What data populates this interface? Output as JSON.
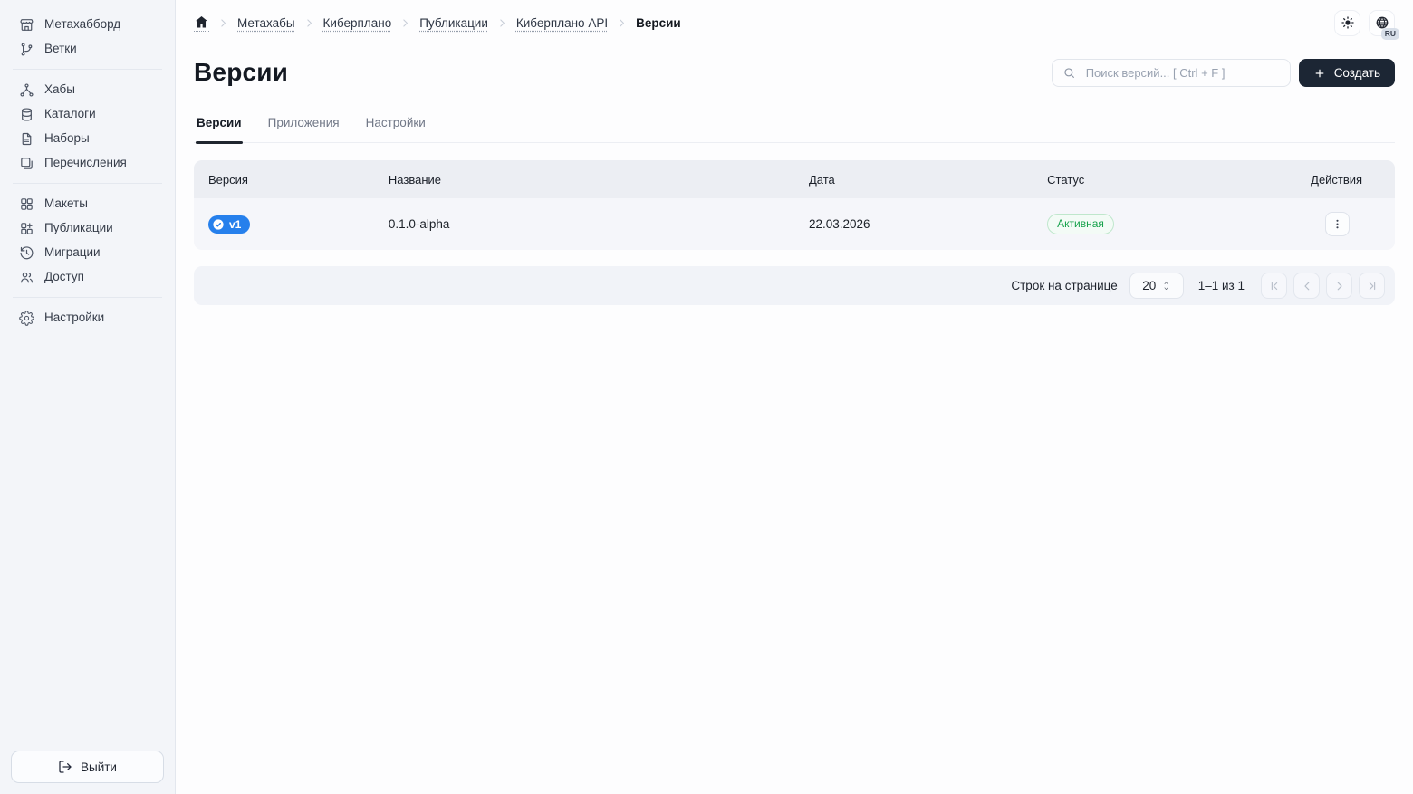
{
  "sidebar": {
    "groups": [
      {
        "items": [
          {
            "key": "metahubboard",
            "label": "Метахабборд",
            "icon": "storefront-icon"
          },
          {
            "key": "branches",
            "label": "Ветки",
            "icon": "git-branch-icon"
          }
        ]
      },
      {
        "items": [
          {
            "key": "hubs",
            "label": "Хабы",
            "icon": "hierarchy-icon"
          },
          {
            "key": "catalogs",
            "label": "Каталоги",
            "icon": "database-icon"
          },
          {
            "key": "sets",
            "label": "Наборы",
            "icon": "file-icon"
          },
          {
            "key": "enumerations",
            "label": "Перечисления",
            "icon": "copy-icon"
          }
        ]
      },
      {
        "items": [
          {
            "key": "layouts",
            "label": "Макеты",
            "icon": "layout-grid-icon"
          },
          {
            "key": "publications",
            "label": "Публикации",
            "icon": "grid-plus-icon"
          },
          {
            "key": "migrations",
            "label": "Миграции",
            "icon": "history-icon"
          },
          {
            "key": "access",
            "label": "Доступ",
            "icon": "users-icon"
          }
        ]
      },
      {
        "items": [
          {
            "key": "settings",
            "label": "Настройки",
            "icon": "gear-icon"
          }
        ]
      }
    ],
    "logout_label": "Выйти"
  },
  "topbar": {
    "language_badge": "RU"
  },
  "breadcrumb": {
    "items": [
      {
        "key": "metahubs",
        "label": "Метахабы",
        "type": "link"
      },
      {
        "key": "kiberplano",
        "label": "Киберплано",
        "type": "link"
      },
      {
        "key": "publications",
        "label": "Публикации",
        "type": "link"
      },
      {
        "key": "kiberplano-api",
        "label": "Киберплано API",
        "type": "link"
      },
      {
        "key": "versions",
        "label": "Версии",
        "type": "current"
      }
    ]
  },
  "page": {
    "title": "Версии",
    "search_placeholder": "Поиск версий... [ Ctrl + F ]",
    "create_label": "Создать",
    "tabs": [
      {
        "key": "versions",
        "label": "Версии",
        "active": true
      },
      {
        "key": "applications",
        "label": "Приложения",
        "active": false
      },
      {
        "key": "settings",
        "label": "Настройки",
        "active": false
      }
    ]
  },
  "table": {
    "columns": [
      "Версия",
      "Название",
      "Дата",
      "Статус",
      "Действия"
    ],
    "rows": [
      {
        "version_badge": "v1",
        "name": "0.1.0-alpha",
        "date": "22.03.2026",
        "status": "Активная"
      }
    ]
  },
  "pagination": {
    "rows_per_page_label": "Строк на странице",
    "rows_per_page": "20",
    "range": "1–1 из 1"
  },
  "colors": {
    "accent_blue": "#2680ec",
    "create_button": "#1c2634",
    "status_green": "#17a24c",
    "status_green_bg": "#f3fbf6",
    "status_green_border": "#bfe7cc",
    "sidebar_bg": "#f3f5f9",
    "table_header_bg": "#eceef3",
    "table_row_bg": "#f5f6fa"
  }
}
